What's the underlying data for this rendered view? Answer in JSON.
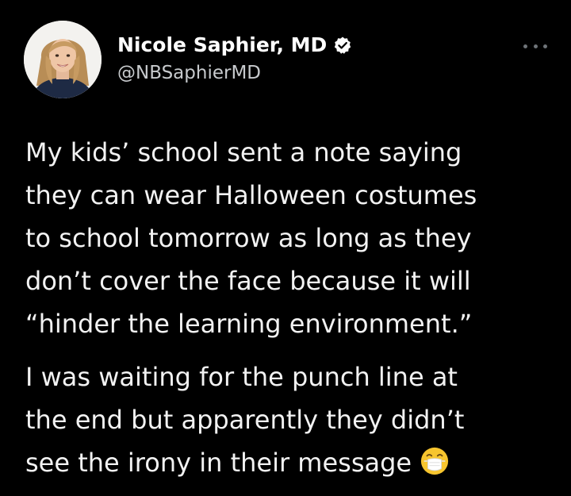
{
  "author": {
    "display_name": "Nicole Saphier, MD",
    "handle": "@NBSaphierMD",
    "verified_icon": "verified-badge-icon",
    "avatar": "profile-photo"
  },
  "menu": {
    "more_icon": "more-options-icon"
  },
  "tweet": {
    "paragraph1": [
      "My kids’ school sent a note saying",
      "they can wear Halloween costumes",
      "to school tomorrow as long as they",
      "don’t cover the face because it will",
      "“hinder the learning environment.”"
    ],
    "paragraph2": [
      "I was waiting for the punch line at",
      "the end but apparently they didn’t",
      "see the irony in their message"
    ],
    "emoji": "face-with-medical-mask-emoji"
  },
  "colors": {
    "background": "#000000",
    "text": "#f2f2f2",
    "handle": "#c7cacd",
    "verified": "#ffffff"
  }
}
